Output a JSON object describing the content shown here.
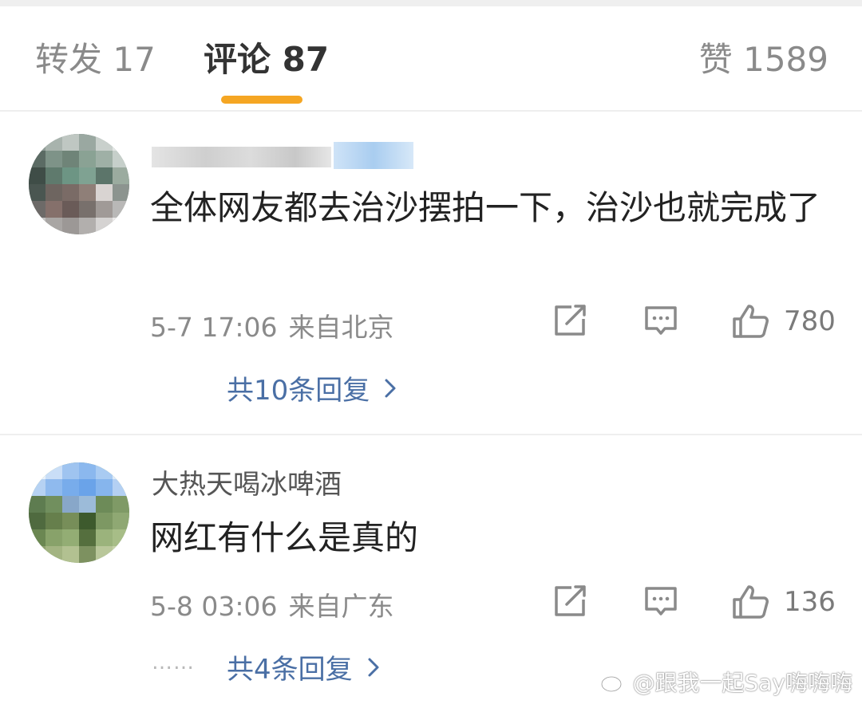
{
  "tabs": {
    "repost": "转发 17",
    "comments": "评论 87",
    "likes": "赞 1589"
  },
  "comments": [
    {
      "username": "",
      "text": "全体网友都去治沙摆拍一下，治沙也就完成了",
      "date": "5-7 17:06",
      "location": "来自北京",
      "like_count": "780",
      "replies": "共10条回复"
    },
    {
      "username": "大热天喝冰啤酒",
      "text": "网红有什么是真的",
      "date": "5-8 03:06",
      "location": "来自广东",
      "like_count": "136",
      "replies": "共4条回复"
    }
  ],
  "reply_dots": "……",
  "watermark": "@跟我一起Say嗨嗨嗨",
  "colors": {
    "accent": "#f5a623",
    "link": "#4a6fa5",
    "muted": "#8a8a8a"
  },
  "icons": [
    "share-icon",
    "comment-icon",
    "like-icon",
    "chevron-right-icon",
    "weibo-logo-icon"
  ]
}
